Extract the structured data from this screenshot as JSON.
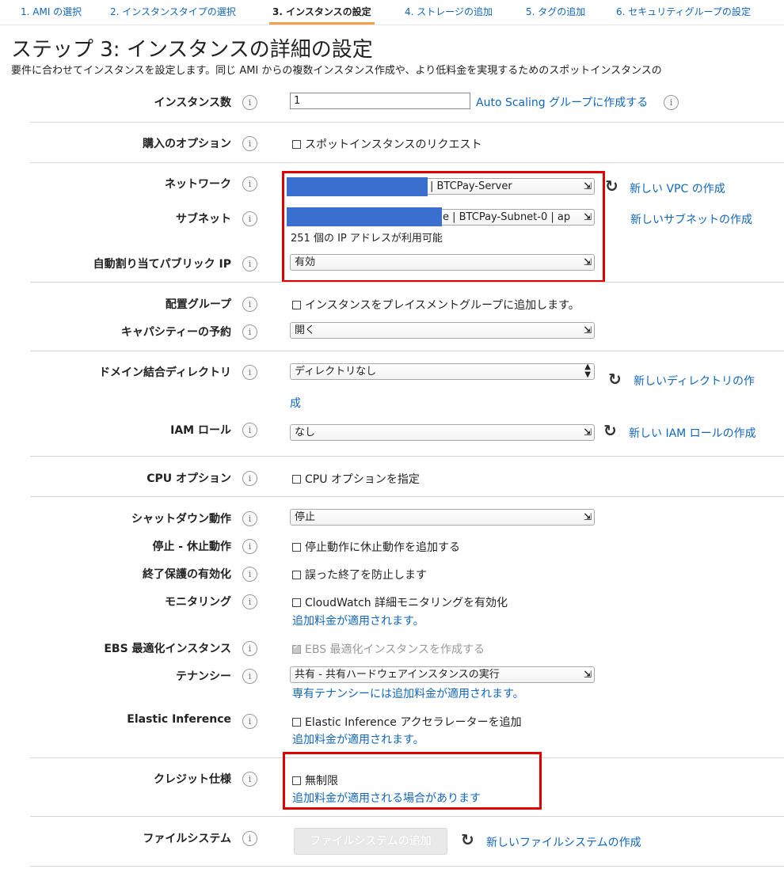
{
  "tabs": [
    {
      "label": "1. AMI の選択"
    },
    {
      "label": "2. インスタンスタイプの選択"
    },
    {
      "label": "3. インスタンスの設定"
    },
    {
      "label": "4. ストレージの追加"
    },
    {
      "label": "5. タグの追加"
    },
    {
      "label": "6. セキュリティグループの設定"
    }
  ],
  "page": {
    "title": "ステップ 3: インスタンスの詳細の設定",
    "description": "要件に合わせてインスタンスを設定します。同じ AMI からの複数インスタンス作成や、より低料金を実現するためのスポットインスタンスの"
  },
  "info_glyph": "i",
  "fields": {
    "instance_count": {
      "label": "インスタンス数",
      "value": "1",
      "link": "Auto Scaling グループに作成する"
    },
    "purchase": {
      "label": "購入のオプション",
      "checkbox": "スポットインスタンスのリクエスト"
    },
    "network": {
      "label": "ネットワーク",
      "value": "| BTCPay-Server",
      "link": "新しい VPC の作成"
    },
    "subnet": {
      "label": "サブネット",
      "value": "e | BTCPay-Subnet-0 | ap",
      "link": "新しいサブネットの作成",
      "note": "251 個の IP アドレスが利用可能"
    },
    "public_ip": {
      "label": "自動割り当てパブリック IP",
      "value": "有効"
    },
    "placement": {
      "label": "配置グループ",
      "checkbox": "インスタンスをプレイスメントグループに追加します。"
    },
    "capacity": {
      "label": "キャパシティーの予約",
      "value": "開く"
    },
    "domain": {
      "label": "ドメイン結合ディレクトリ",
      "value": "ディレクトリなし",
      "link_line1": "新しいディレクトリの作",
      "link_line2": "成"
    },
    "iam": {
      "label": "IAM ロール",
      "value": "なし",
      "link": "新しい IAM ロールの作成"
    },
    "cpu": {
      "label": "CPU オプション",
      "checkbox": "CPU オプションを指定"
    },
    "shutdown": {
      "label": "シャットダウン動作",
      "value": "停止"
    },
    "hibernate": {
      "label": "停止 - 休止動作",
      "checkbox": "停止動作に休止動作を追加する"
    },
    "termination": {
      "label": "終了保護の有効化",
      "checkbox": "誤った終了を防止します"
    },
    "monitoring": {
      "label": "モニタリング",
      "checkbox": "CloudWatch 詳細モニタリングを有効化",
      "link": "追加料金が適用されます。"
    },
    "ebs": {
      "label": "EBS 最適化インスタンス",
      "checkbox": "EBS 最適化インスタンスを作成する"
    },
    "tenancy": {
      "label": "テナンシー",
      "value": "共有 - 共有ハードウェアインスタンスの実行",
      "link": "専有テナンシーには追加料金が適用されます。"
    },
    "elastic": {
      "label": "Elastic Inference",
      "checkbox": "Elastic Inference アクセラレーターを追加",
      "link": "追加料金が適用されます。"
    },
    "credit": {
      "label": "クレジット仕様",
      "checkbox": "無制限",
      "link": "追加料金が適用される場合があります"
    },
    "filesystem": {
      "label": "ファイルシステム",
      "button": "ファイルシステムの追加",
      "link": "新しいファイルシステムの作成"
    }
  },
  "colors": {
    "link": "#1166bb",
    "highlight": "#e00000",
    "redaction": "#3a6fcf",
    "active_tab": "#f0a14a"
  }
}
